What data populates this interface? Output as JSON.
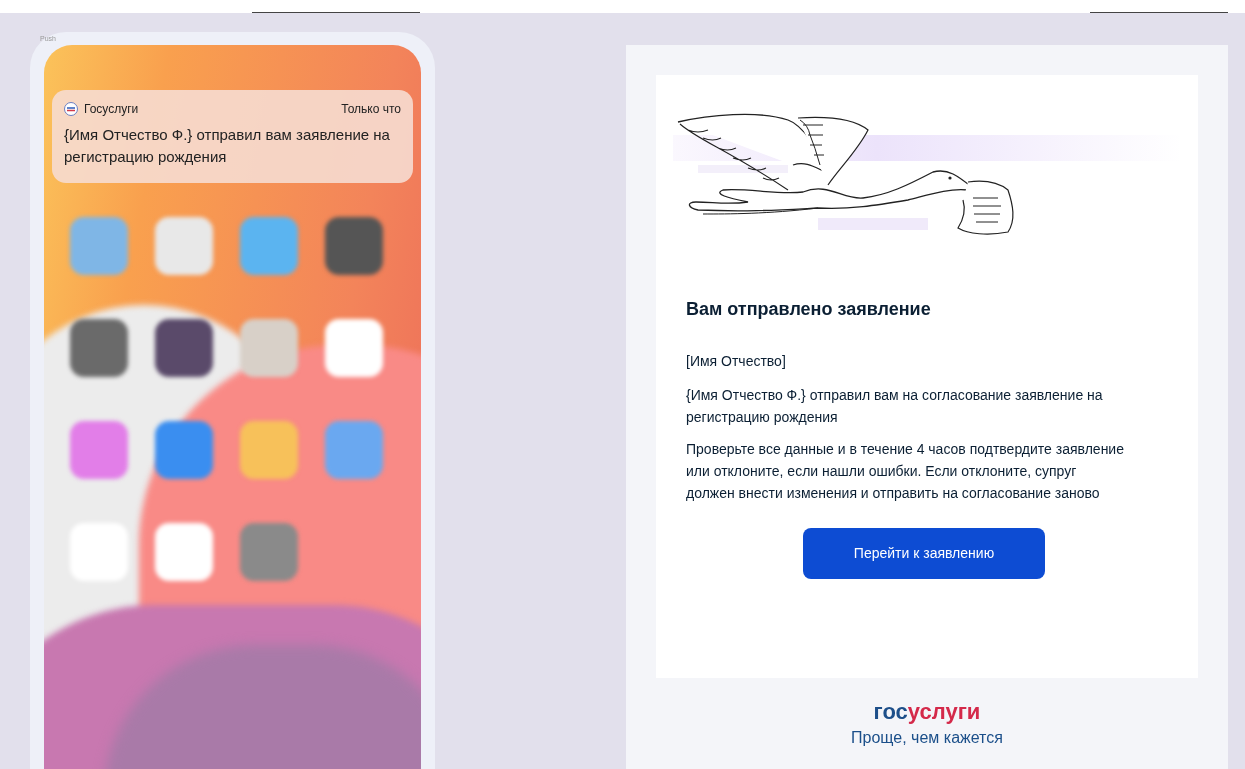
{
  "label": "Push",
  "phone": {
    "notification": {
      "app": "Госуслуги",
      "time": "Только что",
      "text": "{Имя Отчество Ф.} отправил вам заявление на регистрацию рождения"
    }
  },
  "email": {
    "title": "Вам отправлено заявление",
    "greeting": "[Имя Отчество]",
    "paragraphs": [
      "{Имя Отчество Ф.} отправил вам на согласование заявление на регистрацию рождения",
      "Проверьте все данные и в течение 4 часов подтвердите заявление или отклоните, если нашли ошибки. Если отклоните, супруг должен внести изменения и отправить на согласование заново"
    ],
    "button": "Перейти к заявлению",
    "logo": {
      "prefix": "гос",
      "suffix": "услуги"
    },
    "tagline": "Проще, чем кажется"
  }
}
